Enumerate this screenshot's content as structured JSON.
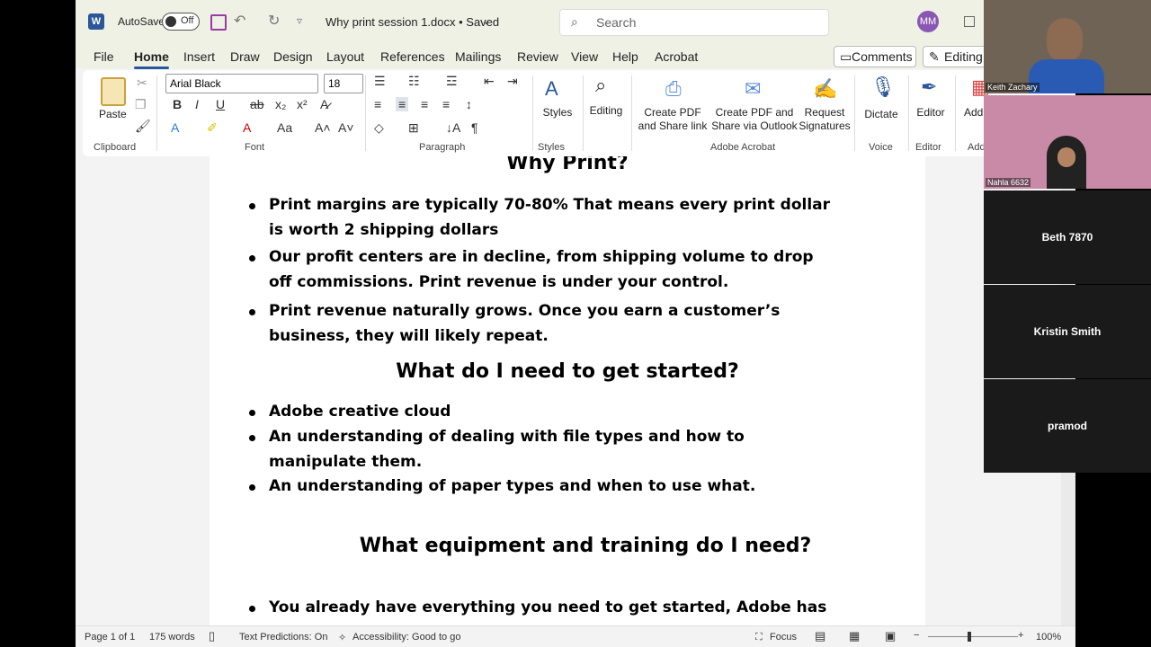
{
  "app": {
    "autosave_label": "AutoSave",
    "autosave_state": "Off",
    "doc_title": "Why print session 1.docx • Saved",
    "search_placeholder": "Search",
    "avatar_initials": "MM"
  },
  "tabs": [
    "File",
    "Home",
    "Insert",
    "Draw",
    "Design",
    "Layout",
    "References",
    "Mailings",
    "Review",
    "View",
    "Help",
    "Acrobat"
  ],
  "top_buttons": {
    "comments": "Comments",
    "editing": "Editing"
  },
  "ribbon": {
    "paste": "Paste",
    "font_name": "Arial Black",
    "font_size": "18",
    "styles": "Styles",
    "editing": "Editing",
    "create_pdf_share": "Create PDF and Share link",
    "create_pdf_outlook": "Create PDF and Share via Outlook",
    "request_signatures": "Request Signatures",
    "dictate": "Dictate",
    "editor": "Editor",
    "addins": "Add",
    "groups": {
      "clipboard": "Clipboard",
      "font": "Font",
      "paragraph": "Paragraph",
      "styles": "Styles",
      "adobe": "Adobe Acrobat",
      "voice": "Voice",
      "editor": "Editor",
      "addins": "Add"
    }
  },
  "document": {
    "heading1": "Why Print?",
    "bullets1": [
      [
        "Print margins are typically 70-80% That means every print dollar",
        "is worth 2 shipping dollars"
      ],
      [
        "Our profit centers are in decline, from shipping volume to drop",
        "off commissions. Print revenue is under your control."
      ],
      [
        "Print revenue naturally grows. Once you earn a customer’s",
        "business, they will likely repeat."
      ]
    ],
    "heading2": "What do I need to get started?",
    "bullets2": [
      [
        "Adobe creative cloud"
      ],
      [
        "An understanding of dealing with file types and how to",
        "manipulate them."
      ],
      [
        "An understanding of paper types and when to use what."
      ]
    ],
    "heading3": "What equipment and training do I need?",
    "bullets3": [
      [
        "You already have everything you need to get started, Adobe has"
      ]
    ]
  },
  "status": {
    "page": "Page 1 of 1",
    "words": "175 words",
    "predictions": "Text Predictions: On",
    "accessibility": "Accessibility: Good to go",
    "focus": "Focus",
    "zoom": "100%"
  },
  "participants": [
    "Keith Zachary",
    "Nahla 6632",
    "Beth 7870",
    "Kristin Smith",
    "pramod"
  ]
}
